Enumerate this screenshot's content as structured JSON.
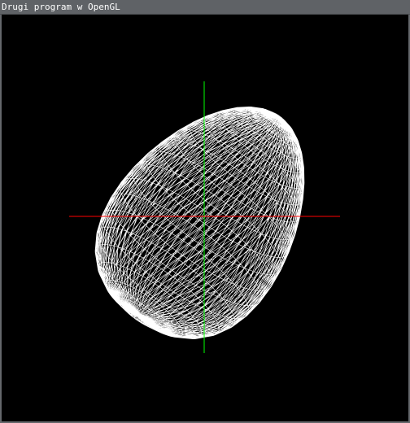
{
  "window": {
    "title": "Drugi program w OpenGL"
  },
  "scene": {
    "background": "#000000",
    "wireframe_color": "#ffffff",
    "x_axis_color": "#ff0000",
    "y_axis_color": "#00ff00",
    "object": "egg-wireframe"
  }
}
